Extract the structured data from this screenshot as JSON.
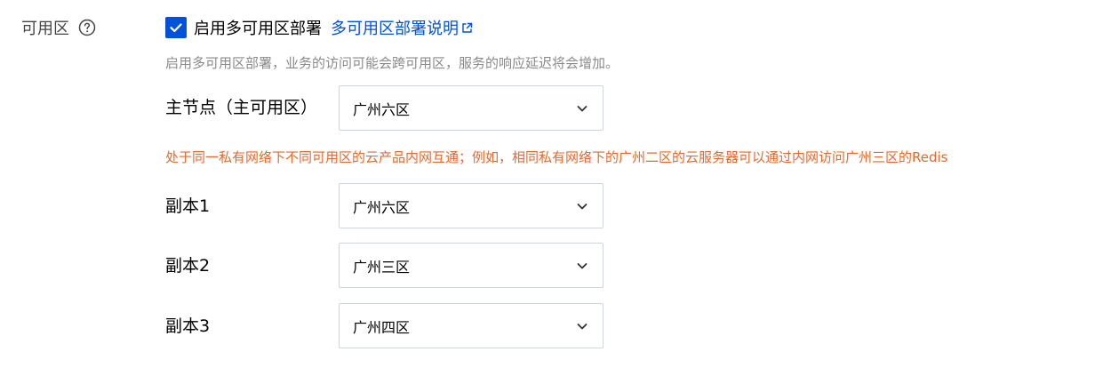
{
  "availability_zone": {
    "label": "可用区",
    "help_icon": "question-circle-icon",
    "multi_az": {
      "checked": true,
      "label": "启用多可用区部署",
      "doc_link": "多可用区部署说明",
      "doc_link_icon": "external-link-icon"
    },
    "hint": "启用多可用区部署，业务的访问可能会跨可用区，服务的响应延迟将会增加。",
    "primary": {
      "label": "主节点（主可用区）",
      "value": "广州六区"
    },
    "warning": "处于同一私有网络下不同可用区的云产品内网互通；例如，相同私有网络下的广州二区的云服务器可以通过内网访问广州三区的Redis",
    "replicas": [
      {
        "label": "副本1",
        "value": "广州六区"
      },
      {
        "label": "副本2",
        "value": "广州三区"
      },
      {
        "label": "副本3",
        "value": "广州四区"
      }
    ],
    "colors": {
      "accent": "#0052d9",
      "warning": "#e36a2e",
      "hint": "#8a8a8a"
    }
  }
}
